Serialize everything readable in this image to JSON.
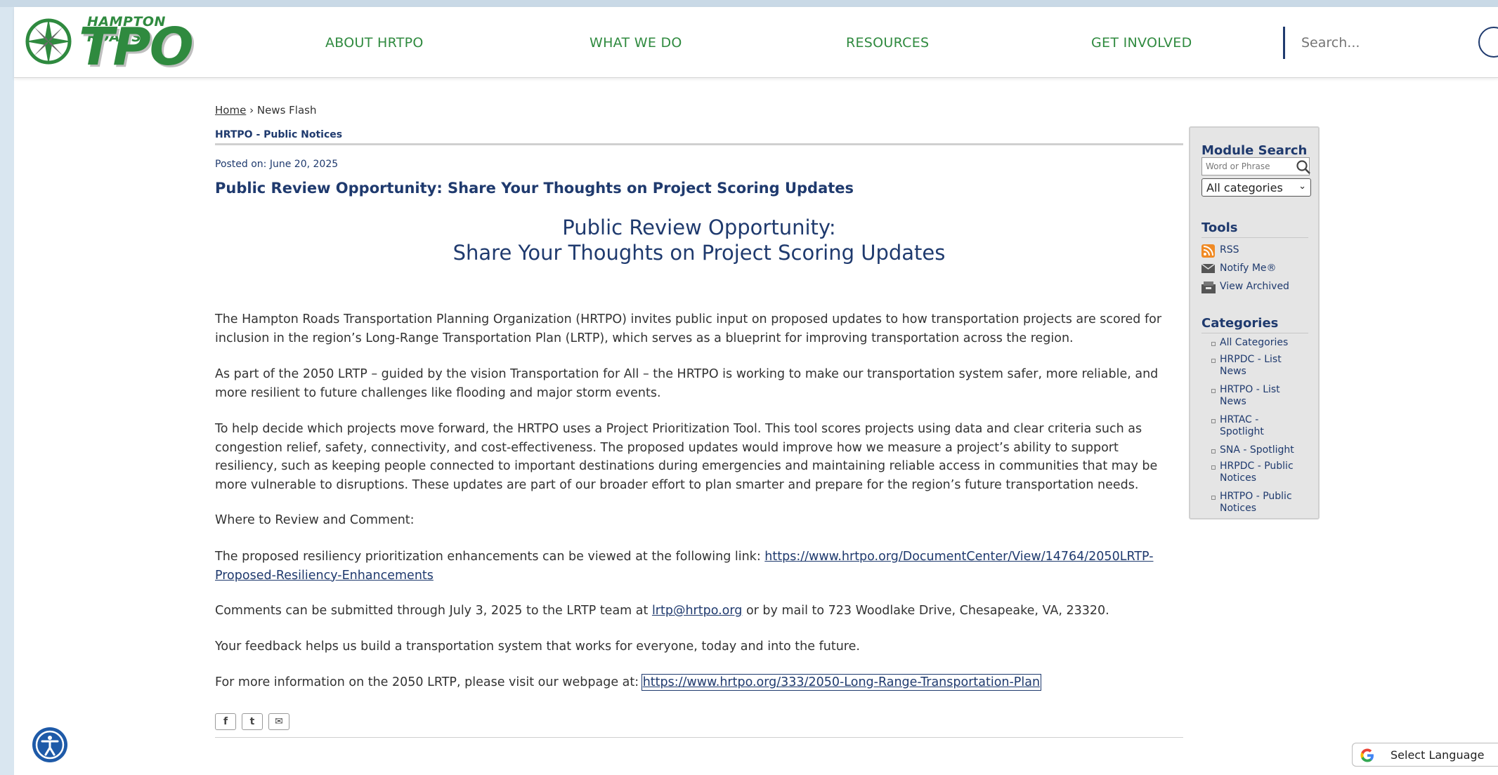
{
  "logo": {
    "small_text": "HAMPTON ROADS",
    "big_text": "TPO"
  },
  "nav": [
    {
      "label": "ABOUT HRTPO"
    },
    {
      "label": "WHAT WE DO"
    },
    {
      "label": "RESOURCES"
    },
    {
      "label": "GET INVOLVED"
    }
  ],
  "search": {
    "placeholder": "Search..."
  },
  "breadcrumb": {
    "home": "Home",
    "separator": "›",
    "current": "News Flash"
  },
  "module": {
    "title": "HRTPO - Public Notices"
  },
  "article": {
    "posted": "Posted on: June 20, 2025",
    "title": "Public Review Opportunity: Share Your Thoughts on Project Scoring Updates",
    "headline_line1": "Public Review Opportunity:",
    "headline_line2": "Share Your Thoughts on Project Scoring Updates",
    "p1": "The Hampton Roads Transportation Planning Organization (HRTPO) invites public input on proposed updates to how transportation projects are scored for inclusion in the region’s Long-Range Transportation Plan (LRTP), which serves as a blueprint for improving transportation across the region.",
    "p2": "As part of the 2050 LRTP – guided by the vision Transportation for All – the HRTPO is working to make our transportation system safer, more reliable, and more resilient to future challenges like flooding and major storm events.",
    "p3": "To help decide which projects move forward, the HRTPO uses a Project Prioritization Tool. This tool scores projects using data and clear criteria such as congestion relief, safety, connectivity, and cost-effectiveness. The proposed updates would improve how we measure a project’s ability to support resiliency, such as keeping people connected to important destinations during emergencies and maintaining reliable access in communities that may be more vulnerable to disruptions. These updates are part of our broader effort to plan smarter and prepare for the region’s future transportation needs.",
    "p4": "Where to Review and Comment:",
    "p5_text": "The proposed resiliency prioritization enhancements can be viewed at the following link: ",
    "p5_link": "https://www.hrtpo.org/DocumentCenter/View/14764/2050LRTP-Proposed-Resiliency-Enhancements",
    "p6_before": "Comments can be submitted through July 3, 2025 to the LRTP team at ",
    "p6_link": "lrtp@hrtpo.org",
    "p6_after": " or by mail to 723 Woodlake Drive, Chesapeake, VA, 23320.",
    "p7": "Your feedback helps us build a transportation system that works for everyone, today and into the future.",
    "p8_text": "For more information on the 2050 LRTP, please visit our webpage at: ",
    "p8_link": "https://www.hrtpo.org/333/2050-Long-Range-Transportation-Plan"
  },
  "share": {
    "facebook": "f",
    "twitter": "t",
    "email": "✉"
  },
  "sidebar": {
    "module_search_heading": "Module Search",
    "search_placeholder": "Word or Phrase",
    "category_select": "All categories",
    "tools_heading": "Tools",
    "tools": [
      {
        "label": "RSS",
        "icon": "rss-icon"
      },
      {
        "label": "Notify Me®",
        "icon": "envelope-icon"
      },
      {
        "label": "View Archived",
        "icon": "archive-icon"
      }
    ],
    "categories_heading": "Categories",
    "categories": [
      {
        "line1": "All Categories",
        "line2": ""
      },
      {
        "line1": "HRPDC - List",
        "line2": "News"
      },
      {
        "line1": "HRTPO - List",
        "line2": "News"
      },
      {
        "line1": "HRTAC -",
        "line2": "Spotlight"
      },
      {
        "line1": "SNA - Spotlight",
        "line2": ""
      },
      {
        "line1": "HRPDC - Public",
        "line2": "Notices"
      },
      {
        "line1": "HRTPO - Public",
        "line2": "Notices"
      }
    ]
  },
  "translate": {
    "label": "Select Language"
  },
  "colors": {
    "brand_green": "#2f8a3f",
    "brand_navy": "#1f3a6e",
    "accessibility_blue": "#1e5aa8"
  }
}
